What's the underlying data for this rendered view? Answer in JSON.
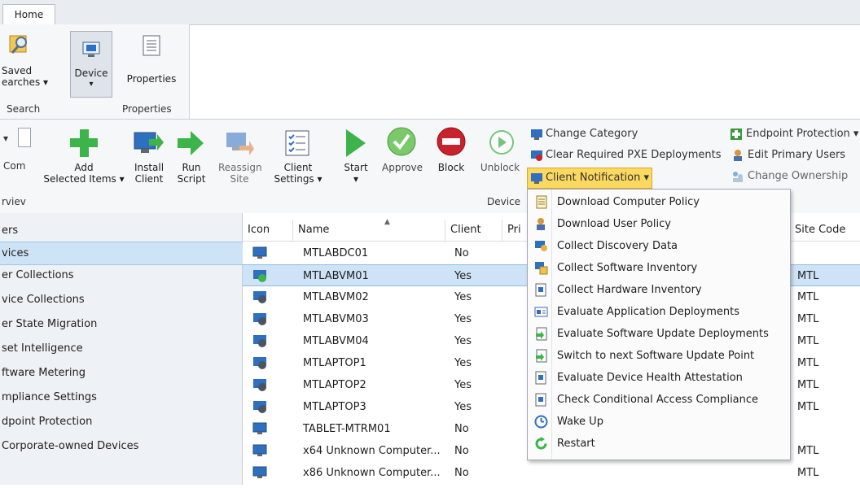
{
  "tabs": [
    {
      "label": "Home"
    }
  ],
  "ribbon_top": {
    "saved_searches": {
      "label1": "Saved",
      "label2": "earches ▾"
    },
    "device": {
      "label": "Device",
      "arrow": "▾"
    },
    "properties": {
      "label": "Properties"
    },
    "groups": {
      "search": "Search",
      "properties": "Properties"
    }
  },
  "ribbon": {
    "left_fragments": {
      "a": "▾",
      "b": "Com",
      "c": "rviev"
    },
    "buttons": {
      "add": {
        "l1": "Add",
        "l2": "Selected Items ▾"
      },
      "install": {
        "l1": "Install",
        "l2": "Client"
      },
      "run": {
        "l1": "Run",
        "l2": "Script"
      },
      "reassign": {
        "l1": "Reassign",
        "l2": "Site"
      },
      "client_settings": {
        "l1": "Client",
        "l2": "Settings ▾"
      },
      "start": {
        "l1": "Start",
        "l2": "▾"
      },
      "approve": {
        "l1": "Approve"
      },
      "block": {
        "l1": "Block"
      },
      "unblock": {
        "l1": "Unblock"
      }
    },
    "device_group": "Device",
    "small": {
      "change_category": "Change Category",
      "clear_pxe": "Clear Required PXE Deployments",
      "client_notification": "Client Notification ▾",
      "endpoint_protection": "Endpoint Protection ▾",
      "edit_primary_users": "Edit Primary Users",
      "change_ownership": "Change Ownership"
    }
  },
  "sidebar": {
    "items": [
      {
        "label": "ers"
      },
      {
        "label": "vices"
      },
      {
        "label": "er Collections"
      },
      {
        "label": "vice Collections"
      },
      {
        "label": "er State Migration"
      },
      {
        "label": "set Intelligence"
      },
      {
        "label": "ftware Metering"
      },
      {
        "label": "mpliance Settings"
      },
      {
        "label": "dpoint Protection"
      },
      {
        "label": " Corporate-owned Devices"
      }
    ]
  },
  "grid": {
    "columns": {
      "icon": "Icon",
      "name": "Name",
      "client": "Client",
      "pri": "Pri",
      "site_code": "Site Code"
    },
    "rows": [
      {
        "name": "MTLABDC01",
        "client": "No",
        "site": ""
      },
      {
        "name": "MTLABVM01",
        "client": "Yes",
        "site": "MTL"
      },
      {
        "name": "MTLABVM02",
        "client": "Yes",
        "site": "MTL"
      },
      {
        "name": "MTLABVM03",
        "client": "Yes",
        "site": "MTL"
      },
      {
        "name": "MTLABVM04",
        "client": "Yes",
        "site": "MTL"
      },
      {
        "name": "MTLAPTOP1",
        "client": "Yes",
        "site": "MTL"
      },
      {
        "name": "MTLAPTOP2",
        "client": "Yes",
        "site": "MTL"
      },
      {
        "name": "MTLAPTOP3",
        "client": "Yes",
        "site": "MTL"
      },
      {
        "name": "TABLET-MTRM01",
        "client": "No",
        "site": ""
      },
      {
        "name": "x64 Unknown Computer...",
        "client": "No",
        "site": "MTL"
      },
      {
        "name": "x86 Unknown Computer...",
        "client": "No",
        "site": "MTL"
      }
    ]
  },
  "menu": {
    "items": [
      {
        "label": "Download Computer Policy",
        "icon": "policy-icon"
      },
      {
        "label": "Download User Policy",
        "icon": "user-icon"
      },
      {
        "label": "Collect Discovery Data",
        "icon": "discovery-icon"
      },
      {
        "label": "Collect Software Inventory",
        "icon": "software-inventory-icon"
      },
      {
        "label": "Collect Hardware Inventory",
        "icon": "hardware-inventory-icon"
      },
      {
        "label": "Evaluate Application Deployments",
        "icon": "application-icon"
      },
      {
        "label": "Evaluate Software Update Deployments",
        "icon": "update-icon"
      },
      {
        "label": "Switch to next Software Update Point",
        "icon": "switch-update-icon"
      },
      {
        "label": "Evaluate Device Health Attestation",
        "icon": "health-icon"
      },
      {
        "label": "Check Conditional Access Compliance",
        "icon": "compliance-icon"
      },
      {
        "label": "Wake Up",
        "icon": "clock-icon"
      },
      {
        "label": "Restart",
        "icon": "restart-icon"
      }
    ]
  }
}
